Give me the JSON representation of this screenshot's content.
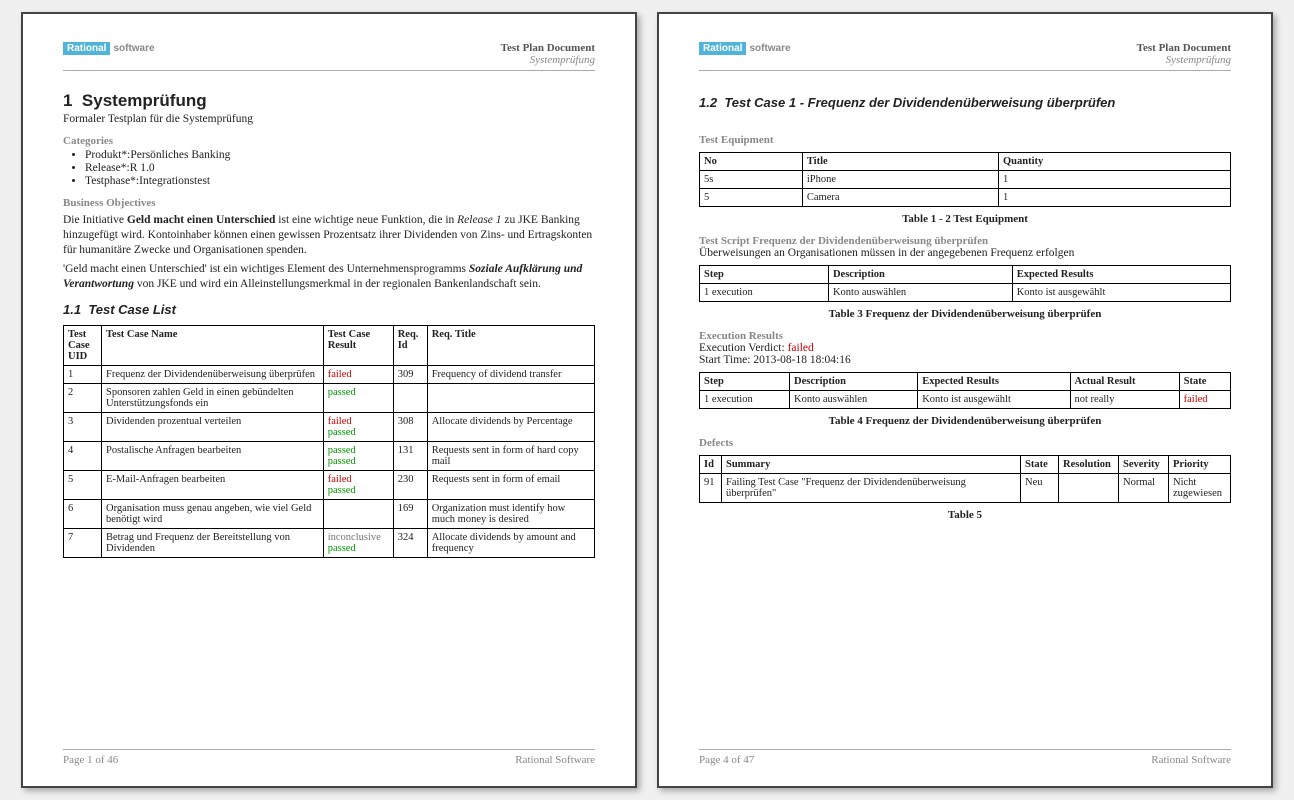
{
  "logo": {
    "brand": "Rational",
    "suffix": "software"
  },
  "header": {
    "doc_title": "Test Plan Document",
    "subtitle": "Systemprüfung"
  },
  "page1": {
    "h1_num": "1",
    "h1_title": "Systemprüfung",
    "subtitle": "Formaler Testplan für die Systemprüfung",
    "categories_label": "Categories",
    "categories": [
      "Produkt*:Persönliches Banking",
      "Release*:R 1.0",
      "Testphase*:Integrationstest"
    ],
    "bo_label": "Business Objectives",
    "bo_para1_a": "Die Initiative ",
    "bo_para1_b": "Geld macht einen Unterschied",
    "bo_para1_c": " ist eine wichtige neue Funktion, die in ",
    "bo_para1_d": "Release 1",
    "bo_para1_e": " zu JKE Banking hinzugefügt wird. Kontoinhaber können einen gewissen Prozentsatz ihrer Dividenden von Zins- und Ertragskonten für humanitäre Zwecke und Organisationen spenden.",
    "bo_para2_a": "'Geld macht einen Unterschied' ist ein wichtiges Element des Unternehmensprogramms ",
    "bo_para2_b": "Soziale Aufklärung und Verantwortung",
    "bo_para2_c": " von JKE und wird ein Alleinstellungsmerkmal in der regionalen Bankenlandschaft sein.",
    "sec11": "1.1",
    "sec11_title": "Test Case List",
    "tcl_headers": [
      "Test Case UID",
      "Test Case Name",
      "Test Case Result",
      "Req. Id",
      "Req. Title"
    ],
    "tcl_rows": [
      {
        "uid": "1",
        "name": "Frequenz der Dividendenüberweisung überprüfen",
        "results": [
          {
            "text": "failed",
            "cls": "failed"
          }
        ],
        "reqid": "309",
        "reqtitle": "Frequency of dividend transfer"
      },
      {
        "uid": "2",
        "name": "Sponsoren zahlen Geld in einen gebündelten Unterstützungsfonds ein",
        "results": [
          {
            "text": "passed",
            "cls": "passed"
          }
        ],
        "reqid": "",
        "reqtitle": ""
      },
      {
        "uid": "3",
        "name": "Dividenden prozentual verteilen",
        "results": [
          {
            "text": "failed",
            "cls": "failed"
          },
          {
            "text": "passed",
            "cls": "passed"
          }
        ],
        "reqid": "308",
        "reqtitle": "Allocate dividends by Percentage"
      },
      {
        "uid": "4",
        "name": "Postalische Anfragen bearbeiten",
        "results": [
          {
            "text": "passed",
            "cls": "passed"
          },
          {
            "text": "passed",
            "cls": "passed"
          }
        ],
        "reqid": "131",
        "reqtitle": "Requests sent in form of hard copy mail"
      },
      {
        "uid": "5",
        "name": "E-Mail-Anfragen bearbeiten",
        "results": [
          {
            "text": "failed",
            "cls": "failed"
          },
          {
            "text": "passed",
            "cls": "passed"
          }
        ],
        "reqid": "230",
        "reqtitle": "Requests sent in form of email"
      },
      {
        "uid": "6",
        "name": "Organisation muss genau angeben, wie viel Geld benötigt wird",
        "results": [],
        "reqid": "169",
        "reqtitle": "Organization must identify how much money is desired"
      },
      {
        "uid": "7",
        "name": "Betrag und Frequenz der Bereitstellung von Dividenden",
        "results": [
          {
            "text": "inconclusive",
            "cls": "inconclusive"
          },
          {
            "text": "passed",
            "cls": "passed"
          }
        ],
        "reqid": "324",
        "reqtitle": "Allocate dividends by amount and frequency"
      }
    ],
    "footer_left": "Page 1 of  46",
    "footer_right": "Rational Software"
  },
  "page2": {
    "sec12": "1.2",
    "sec12_title": "Test Case 1 - Frequenz der Dividendenüberweisung überprüfen",
    "te_label": "Test Equipment",
    "te_headers": [
      "No",
      "Title",
      "Quantity"
    ],
    "te_rows": [
      {
        "no": "5s",
        "title": "iPhone",
        "qty": "1"
      },
      {
        "no": "5",
        "title": "Camera",
        "qty": "1"
      }
    ],
    "te_caption": "Table 1 - 2 Test Equipment",
    "ts_label": "Test Script Frequenz der Dividendenüberweisung überprüfen",
    "ts_desc": "Überweisungen an Organisationen müssen in der angegebenen Frequenz erfolgen",
    "ts_headers": [
      "Step",
      "Description",
      "Expected Results"
    ],
    "ts_rows": [
      {
        "step": "1 execution",
        "desc": "Konto auswählen",
        "exp": "Konto ist ausgewählt"
      }
    ],
    "ts_caption": "Table 3 Frequenz der Dividendenüberweisung überprüfen",
    "er_label": "Execution Results",
    "er_verdict_label": "Execution Verdict: ",
    "er_verdict": "failed",
    "er_start": "Start Time: 2013-08-18 18:04:16",
    "er_headers": [
      "Step",
      "Description",
      "Expected Results",
      "Actual Result",
      "State"
    ],
    "er_rows": [
      {
        "step": "1 execution",
        "desc": "Konto auswählen",
        "exp": "Konto ist ausgewählt",
        "act": "not really",
        "state": "failed",
        "state_cls": "failed"
      }
    ],
    "er_caption": "Table 4 Frequenz der Dividendenüberweisung überprüfen",
    "def_label": "Defects",
    "def_headers": [
      "Id",
      "Summary",
      "State",
      "Resolution",
      "Severity",
      "Priority"
    ],
    "def_rows": [
      {
        "id": "91",
        "summary": "Failing Test Case \"Frequenz der Dividendenüberweisung überprüfen\"",
        "state": "Neu",
        "res": "",
        "sev": "Normal",
        "prio": "Nicht zugewiesen"
      }
    ],
    "def_caption": "Table 5",
    "footer_left": "Page 4 of  47",
    "footer_right": "Rational Software"
  }
}
